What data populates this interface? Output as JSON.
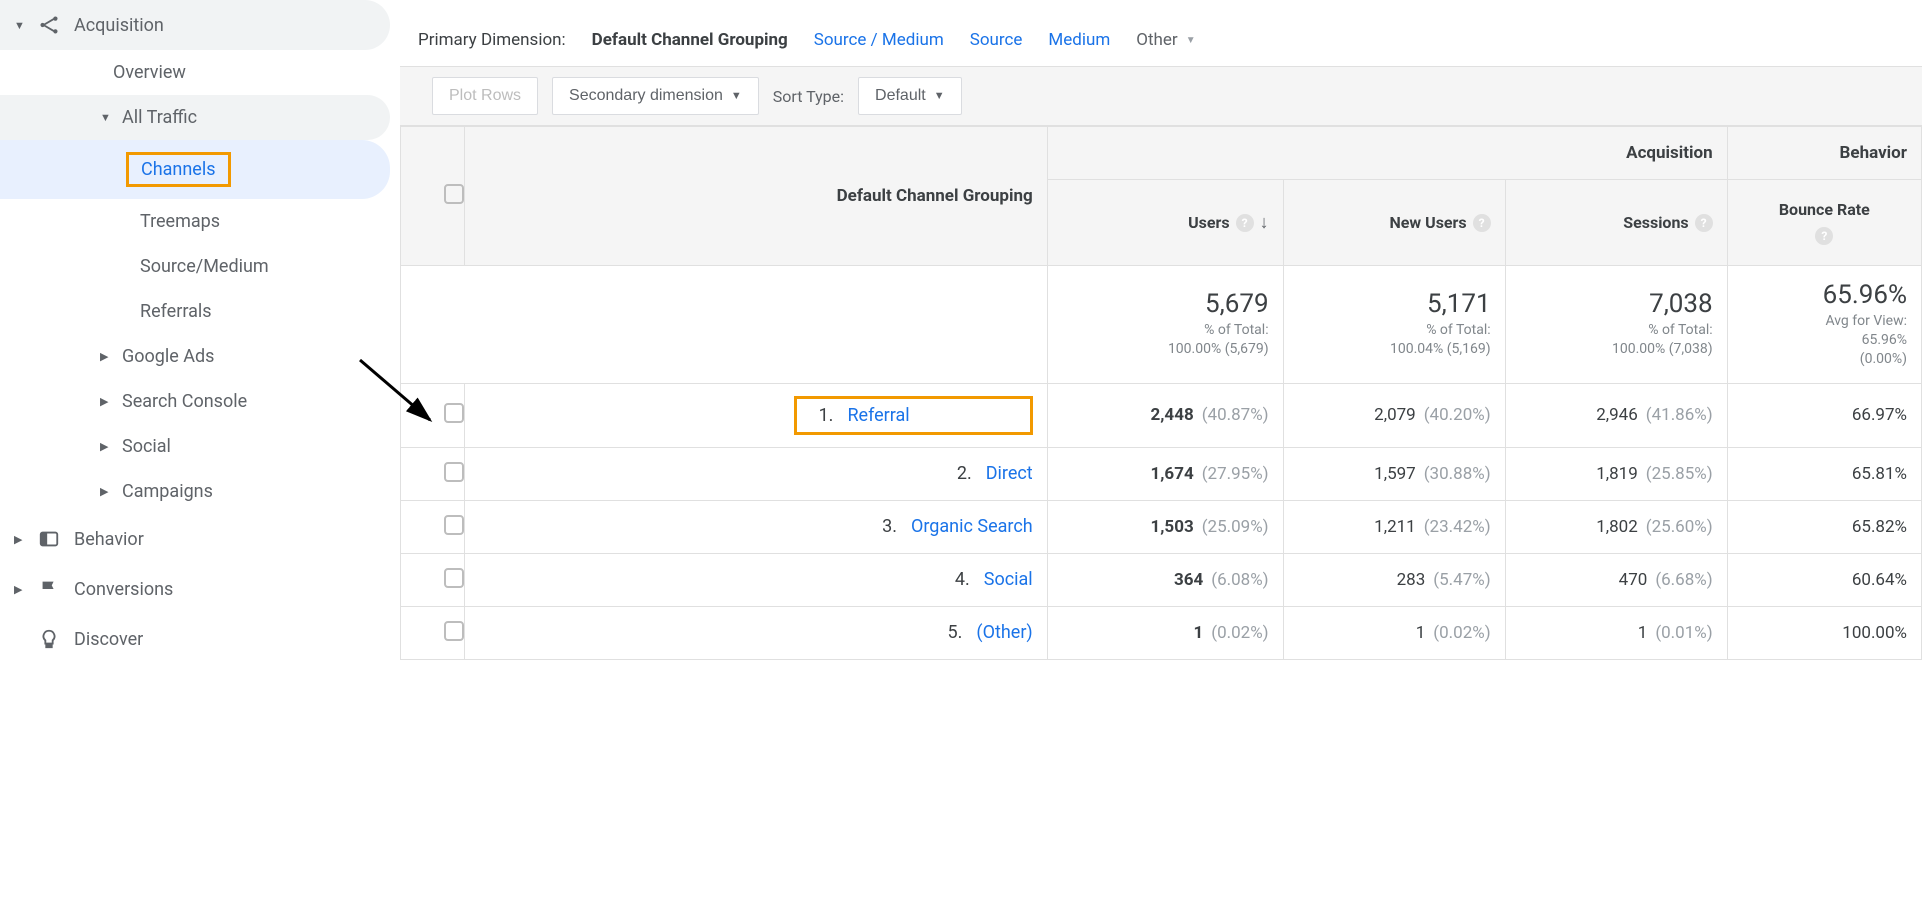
{
  "sidebar": {
    "acquisition": "Acquisition",
    "overview": "Overview",
    "allTraffic": "All Traffic",
    "channels": "Channels",
    "treemaps": "Treemaps",
    "sourceMedium": "Source/Medium",
    "referrals": "Referrals",
    "googleAds": "Google Ads",
    "searchConsole": "Search Console",
    "social": "Social",
    "campaigns": "Campaigns",
    "behavior": "Behavior",
    "conversions": "Conversions",
    "discover": "Discover"
  },
  "dimensionBar": {
    "label": "Primary Dimension:",
    "active": "Default Channel Grouping",
    "links": [
      "Source / Medium",
      "Source",
      "Medium"
    ],
    "other": "Other"
  },
  "toolbar": {
    "plotRows": "Plot Rows",
    "secondary": "Secondary dimension",
    "sortTypeLabel": "Sort Type:",
    "sortDefault": "Default"
  },
  "table": {
    "dimHeader": "Default Channel Grouping",
    "groupAcq": "Acquisition",
    "groupBeh": "Behavior",
    "cols": {
      "users": "Users",
      "newUsers": "New Users",
      "sessions": "Sessions",
      "bounce": "Bounce Rate"
    },
    "totals": {
      "users": {
        "v": "5,679",
        "s1": "% of Total:",
        "s2": "100.00% (5,679)"
      },
      "newUsers": {
        "v": "5,171",
        "s1": "% of Total:",
        "s2": "100.04% (5,169)"
      },
      "sessions": {
        "v": "7,038",
        "s1": "% of Total:",
        "s2": "100.00% (7,038)"
      },
      "bounce": {
        "v": "65.96%",
        "s1": "Avg for View:",
        "s2": "65.96%",
        "s3": "(0.00%)"
      }
    },
    "rows": [
      {
        "n": "1.",
        "name": "Referral",
        "users": "2,448",
        "usersPct": "(40.87%)",
        "nu": "2,079",
        "nuPct": "(40.20%)",
        "sess": "2,946",
        "sessPct": "(41.86%)",
        "bounce": "66.97%"
      },
      {
        "n": "2.",
        "name": "Direct",
        "users": "1,674",
        "usersPct": "(27.95%)",
        "nu": "1,597",
        "nuPct": "(30.88%)",
        "sess": "1,819",
        "sessPct": "(25.85%)",
        "bounce": "65.81%"
      },
      {
        "n": "3.",
        "name": "Organic Search",
        "users": "1,503",
        "usersPct": "(25.09%)",
        "nu": "1,211",
        "nuPct": "(23.42%)",
        "sess": "1,802",
        "sessPct": "(25.60%)",
        "bounce": "65.82%"
      },
      {
        "n": "4.",
        "name": "Social",
        "users": "364",
        "usersPct": "(6.08%)",
        "nu": "283",
        "nuPct": "(5.47%)",
        "sess": "470",
        "sessPct": "(6.68%)",
        "bounce": "60.64%"
      },
      {
        "n": "5.",
        "name": "(Other)",
        "users": "1",
        "usersPct": "(0.02%)",
        "nu": "1",
        "nuPct": "(0.02%)",
        "sess": "1",
        "sessPct": "(0.01%)",
        "bounce": "100.00%"
      }
    ]
  }
}
